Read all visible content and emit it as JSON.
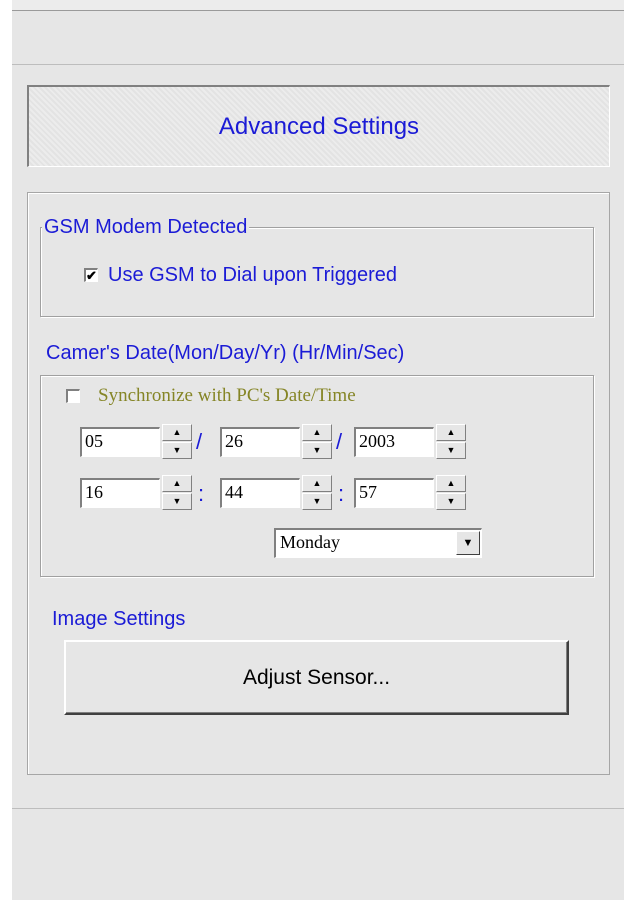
{
  "title": "Advanced Settings",
  "gsm": {
    "group_label": "GSM Modem Detected",
    "checkbox_label": "Use GSM to Dial upon Triggered",
    "checked": true
  },
  "date": {
    "group_label": "Camer's Date(Mon/Day/Yr) (Hr/Min/Sec)",
    "sync_label": "Synchronize with PC's Date/Time",
    "sync_checked": false,
    "month": "05",
    "day": "26",
    "year": "2003",
    "hour": "16",
    "minute": "44",
    "second": "57",
    "date_sep": "/",
    "time_sep": ":",
    "weekday": "Monday",
    "up_glyph": "▲",
    "down_glyph": "▼",
    "check_glyph": "✔"
  },
  "image": {
    "section_label": "Image Settings",
    "adjust_button": "Adjust Sensor..."
  },
  "colors": {
    "label_blue": "#1b1bd6",
    "label_olive": "#858526",
    "panel_bg": "#e6e6e6"
  }
}
